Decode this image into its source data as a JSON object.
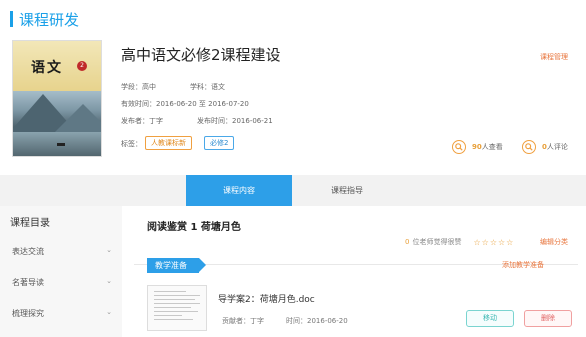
{
  "header": {
    "title": "课程研发"
  },
  "book": {
    "cover_title": "语文",
    "badge": "2"
  },
  "course": {
    "title": "高中语文必修2课程建设",
    "stage_label": "学段：",
    "stage_value": "高中",
    "subject_label": "学科：",
    "subject_value": "语文",
    "valid_label": "有效时间：",
    "valid_start": "2016-06-20",
    "valid_to": "至",
    "valid_end": "2016-07-20",
    "publisher_label": "发布者：",
    "publisher_value": "丁字",
    "publish_time_label": "发布时间：",
    "publish_time_value": "2016-06-21",
    "tags_label": "标签：",
    "tags": [
      "人教课标新",
      "必修2"
    ]
  },
  "actions": {
    "manage": "课程管理"
  },
  "stats": {
    "views_num": "90",
    "views_label": "人查看",
    "comments_num": "0",
    "comments_label": "人评论"
  },
  "tabs": [
    {
      "label": "课程内容"
    },
    {
      "label": "课程指导"
    }
  ],
  "sidebar": {
    "heading": "课程目录",
    "items": [
      {
        "label": "表达交流"
      },
      {
        "label": "名著导读"
      },
      {
        "label": "梳理探究"
      }
    ]
  },
  "lesson": {
    "title": "阅读鉴赏 1 荷塘月色",
    "rating_count": "0",
    "rating_text": "位老师觉得很赞",
    "stars": "☆☆☆☆☆",
    "edit_category": "编辑分类"
  },
  "section": {
    "tag": "教学准备",
    "add_link": "添加教学准备"
  },
  "document": {
    "name": "导学案2：荷塘月色.doc",
    "contributor_label": "贡献者：",
    "contributor_value": "丁字",
    "time_label": "时间：",
    "time_value": "2016-06-20",
    "move_label": "移动",
    "delete_label": "删除"
  },
  "colors": {
    "accent": "#2d9fe8",
    "link": "#e8743b",
    "star": "#e8a03a"
  }
}
